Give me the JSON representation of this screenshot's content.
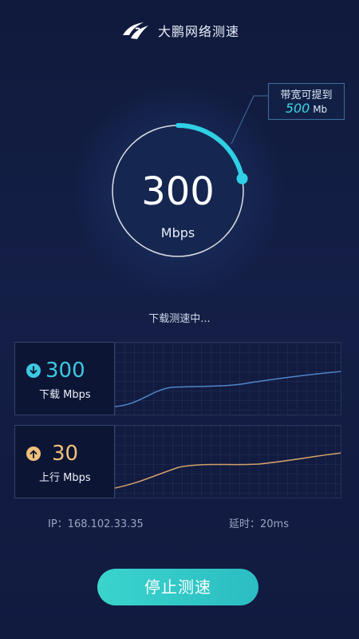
{
  "header": {
    "title": "大鹏网络测速",
    "logo_icon": "bird-logo-icon"
  },
  "gauge": {
    "value": "300",
    "unit": "Mbps",
    "progress_fraction": 0.22,
    "accent_color": "#2fd0e6"
  },
  "callout": {
    "line1": "带宽可提到",
    "max_value": "500",
    "max_unit": "Mb"
  },
  "status_text": "下载测速中...",
  "download": {
    "icon": "download-arrow-icon",
    "value": "300",
    "label": "下载 Mbps",
    "line_color": "#4f86c9"
  },
  "upload": {
    "icon": "upload-arrow-icon",
    "value": "30",
    "label": "上行 Mbps",
    "line_color": "#d2a06a"
  },
  "info": {
    "ip": "IP：168.102.33.35",
    "latency": "延时：20ms"
  },
  "stop_button": {
    "label": "停止测速",
    "color": "#35cdc8"
  }
}
